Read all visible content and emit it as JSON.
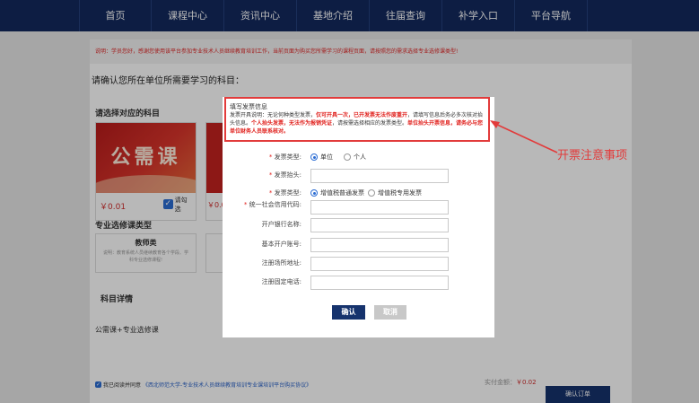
{
  "nav": {
    "items": [
      "首页",
      "课程中心",
      "资讯中心",
      "基地介绍",
      "往届查询",
      "补学入口",
      "平台导航"
    ]
  },
  "notice": "说明：学员您好，感谢您使用该平台参加专业技术人员继续教育培训工作，当前页面为购买您所需学习的课程页面，请按照您的需求选择专业选修课类型!",
  "confirm_title": "请确认您所在单位所需要学习的科目：",
  "select_subject_title": "请选择对应的科目",
  "course": {
    "image_label": "公需课",
    "price": "￥0.01",
    "check_label": "请勾选",
    "second_price": "￥0.0"
  },
  "elective": {
    "title": "专业选修课类型",
    "name": "教师类",
    "desc": "说明：教育系统人员继续教育各个学段、学科专业选修课程!"
  },
  "subject_detail": {
    "title": "科目详情",
    "body": "公需课+专业选修课"
  },
  "agree": {
    "prefix": "我已阅读并同意",
    "link": "《西北师范大学-专业技术人员继续教育培训专业课培训平台购买协议》"
  },
  "pay": {
    "label": "实付金额：",
    "amount": "￥0.02"
  },
  "order_button": "确认订单",
  "modal": {
    "heading": "填写发票信息",
    "info_1": "发票开具说明：无论何种类型发票，",
    "info_red_1": "仅可开具一次，已开发票无法作废重开",
    "info_2": "，请填写信息后务必多次核对抬头信息。",
    "info_red_2": "个人抬头发票，无法作为报销凭证",
    "info_3": "，请按需选择相应的发票类型。",
    "info_red_3": "单位抬头开票信息，请务必与您单位财务人员联系核对。",
    "fields": {
      "invoice_type_label": "发票类型:",
      "invoice_type_opt1": "单位",
      "invoice_type_opt2": "个人",
      "invoice_title_label": "发票抬头:",
      "invoice_kind_label": "发票类型:",
      "invoice_kind_opt1": "增值税普通发票",
      "invoice_kind_opt2": "增值税专用发票",
      "credit_code_label": "统一社会信用代码:",
      "bank_label": "开户银行名称:",
      "account_label": "基本开户账号:",
      "address_label": "注册场所地址:",
      "phone_label": "注册固定电话:"
    },
    "confirm_button": "确认",
    "cancel_button": "取消"
  },
  "annotation": "开票注意事项",
  "colors": {
    "nav_bg": "#12295e",
    "primary": "#16336d",
    "accent_red": "#e23b3b"
  }
}
